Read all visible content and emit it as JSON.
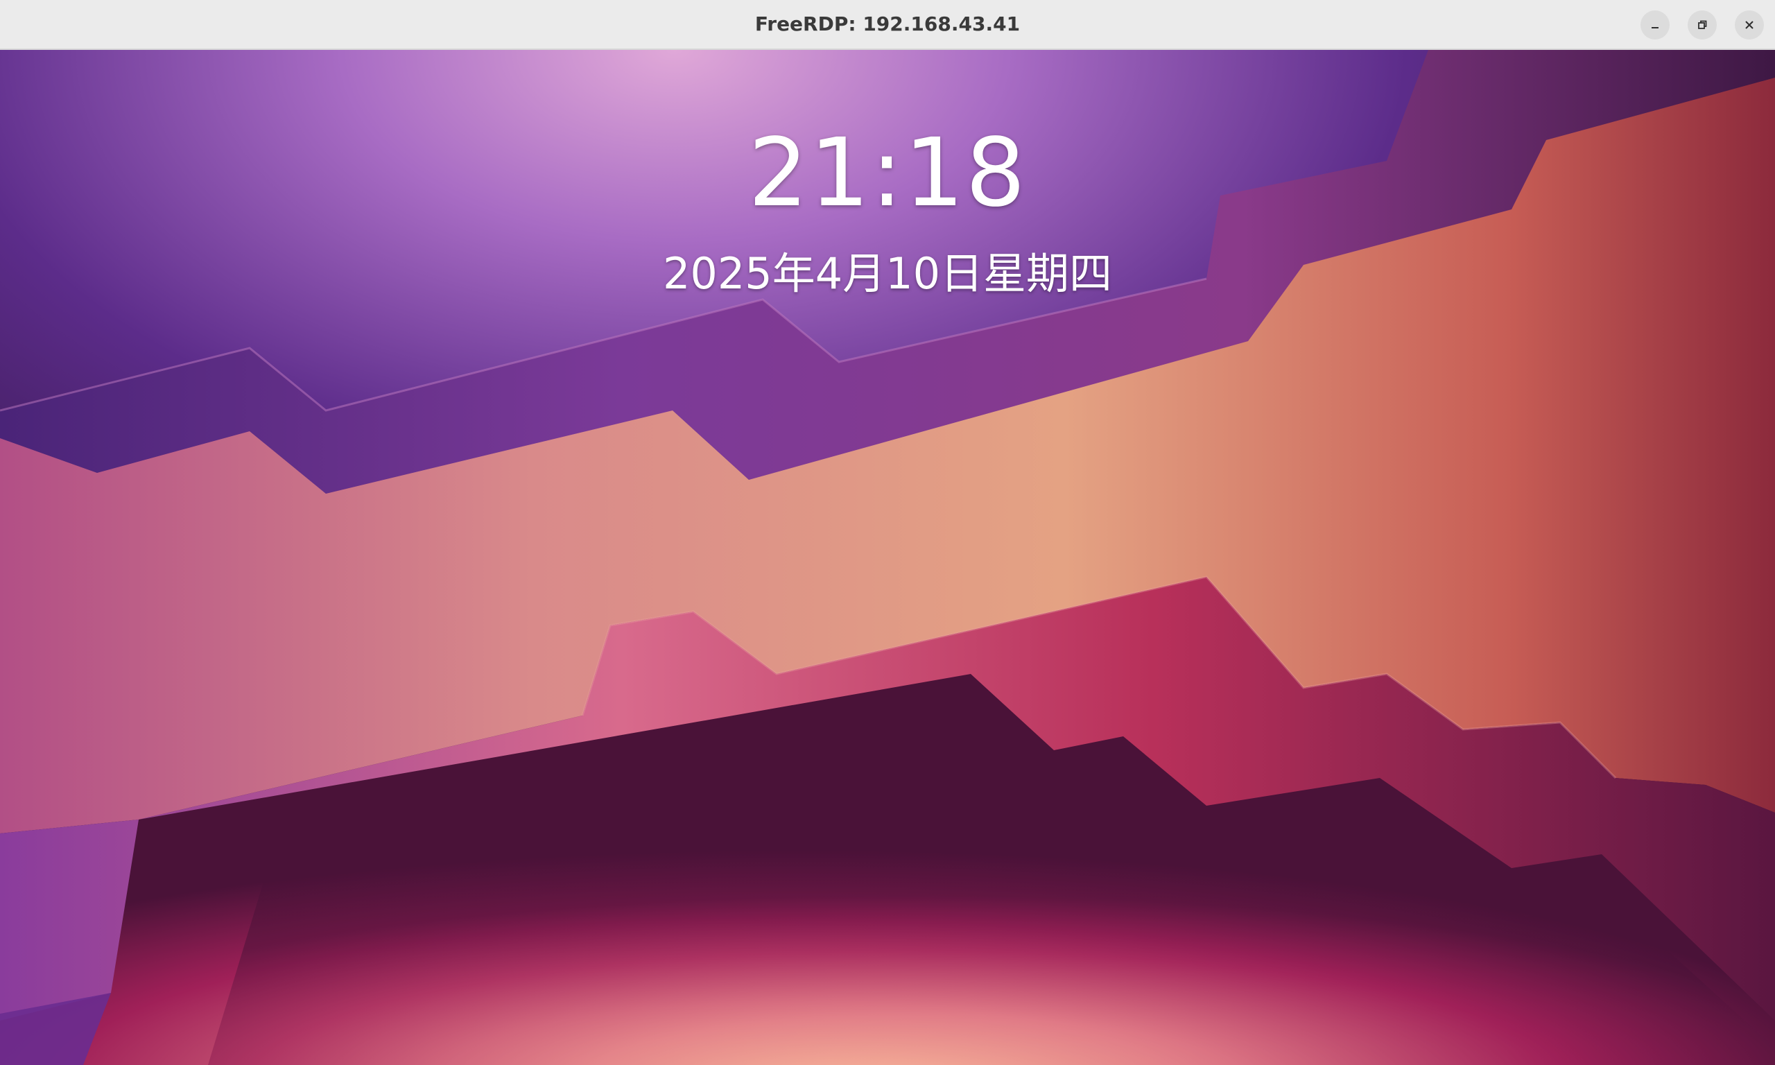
{
  "window": {
    "title": "FreeRDP: 192.168.43.41",
    "controls": {
      "minimize_icon": "minimize-icon",
      "maximize_icon": "restore-icon",
      "close_icon": "close-icon"
    }
  },
  "lock_screen": {
    "time": "21:18",
    "date": "2025年4月10日星期四"
  },
  "colors": {
    "titlebar_bg": "#ebebeb",
    "title_text": "#3a3a3a",
    "wallpaper_purple": "#5b2a86",
    "wallpaper_peach": "#f0a58a",
    "wallpaper_magenta": "#a8285e",
    "wallpaper_dark": "#2a0f2e"
  }
}
